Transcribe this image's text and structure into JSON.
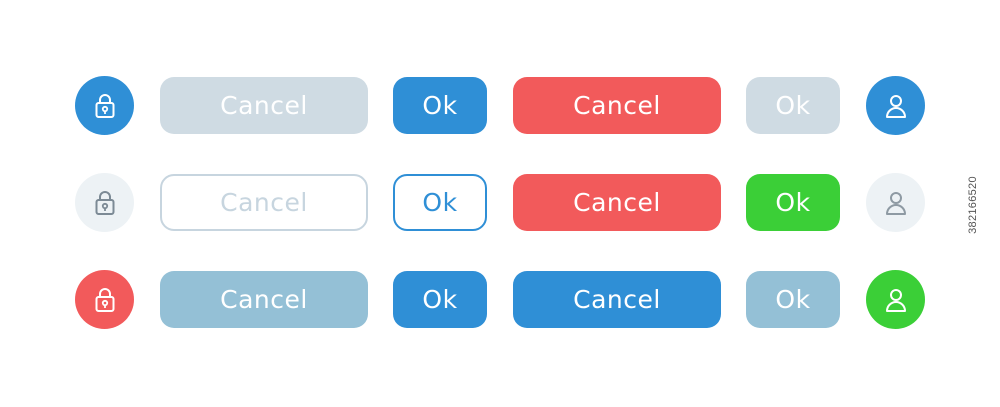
{
  "colors": {
    "blue": "#2f8fd6",
    "light_gray_blue": "#cfdbe3",
    "outline_gray": "#c7d5df",
    "red": "#f25a5b",
    "green": "#3bcf37",
    "muted_blue": "#94c0d6",
    "pale_circle": "#edf2f5"
  },
  "rows": [
    {
      "lock_icon": "lock-icon",
      "cancel_primary": "Cancel",
      "ok_primary": "Ok",
      "cancel_secondary": "Cancel",
      "ok_secondary": "Ok",
      "user_icon": "user-icon"
    },
    {
      "lock_icon": "lock-icon",
      "cancel_primary": "Cancel",
      "ok_primary": "Ok",
      "cancel_secondary": "Cancel",
      "ok_secondary": "Ok",
      "user_icon": "user-icon"
    },
    {
      "lock_icon": "lock-icon",
      "cancel_primary": "Cancel",
      "ok_primary": "Ok",
      "cancel_secondary": "Cancel",
      "ok_secondary": "Ok",
      "user_icon": "user-icon"
    }
  ],
  "side_id": "382166520"
}
